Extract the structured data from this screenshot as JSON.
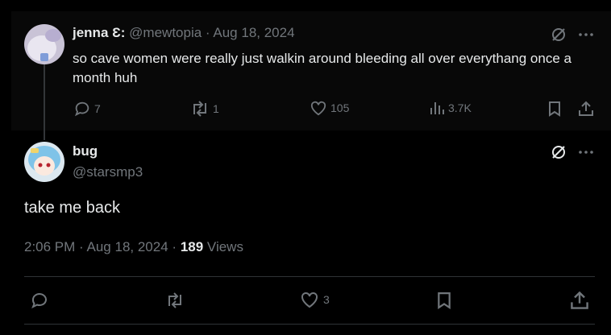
{
  "parent_post": {
    "display_name": "jenna Ɛ:",
    "handle": "@mewtopia",
    "separator": "·",
    "date": "Aug 18, 2024",
    "text": "so cave women were really just walkin around bleeding all over everythang once a month huh",
    "replies": "7",
    "reposts": "1",
    "likes": "105",
    "views": "3.7K"
  },
  "main_post": {
    "display_name": "bug",
    "handle": "@starsmp3",
    "text": "take me back",
    "time": "2:06 PM",
    "separator": "·",
    "date": "Aug 18, 2024",
    "views_count": "189",
    "views_label": "Views",
    "likes": "3"
  },
  "colors": {
    "background": "#000000",
    "parent_background": "#080808",
    "text": "#e7e9ea",
    "muted": "#71767b",
    "divider": "#2f3336"
  },
  "icons": [
    "grok-icon",
    "more-icon",
    "reply-icon",
    "repost-icon",
    "like-icon",
    "views-icon",
    "bookmark-icon",
    "share-icon"
  ]
}
